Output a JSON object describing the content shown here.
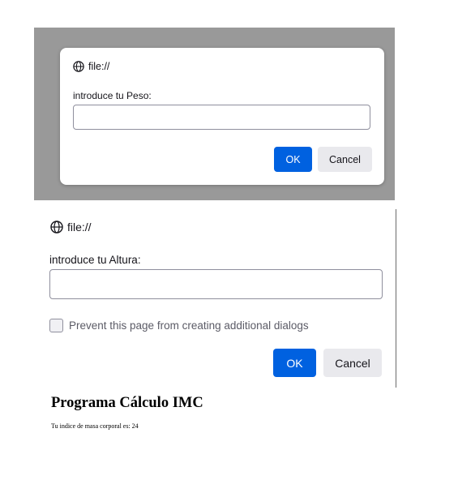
{
  "dialog_peso": {
    "origin": "file://",
    "origin_icon": "globe-icon",
    "message": "introduce tu Peso:",
    "input_value": "",
    "ok_label": "OK",
    "cancel_label": "Cancel"
  },
  "dialog_altura": {
    "origin": "file://",
    "origin_icon": "globe-icon",
    "message": "introduce tu Altura:",
    "input_value": "",
    "checkbox_label": "Prevent this page from creating additional dialogs",
    "checkbox_checked": false,
    "ok_label": "OK",
    "cancel_label": "Cancel"
  },
  "page": {
    "title": "Programa Cálculo IMC",
    "result_text": "Tu indice de masa corporal es: 24"
  },
  "colors": {
    "accent": "#0061e0",
    "backdrop": "#999999",
    "cancel_bg": "#e9e9ed"
  }
}
